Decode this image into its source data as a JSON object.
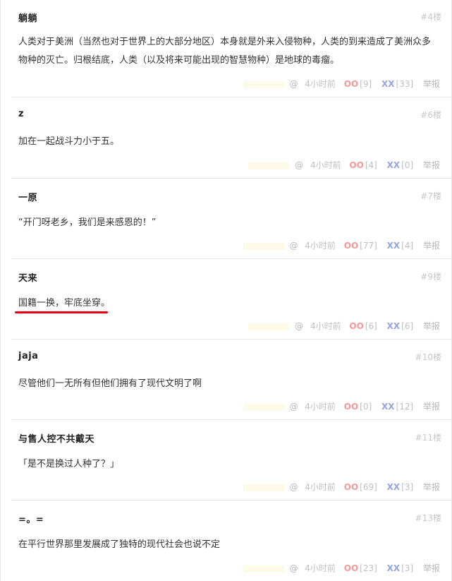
{
  "comments": [
    {
      "author": "躺躺",
      "floor": "#4楼",
      "text": "人类对于美洲（当然也对于世界上的大部分地区）本身就是外来入侵物种，人类的到来造成了美洲众多物种的灭亡。归根结底，人类（以及将来可能出现的智慧物种）是地球的毒瘤。",
      "time": "4小时前",
      "oo_count": "[9]",
      "xx_count": "[33]"
    },
    {
      "author": "z",
      "floor": "#6楼",
      "text": "加在一起战斗力小于五。",
      "time": "4小时前",
      "oo_count": "[4]",
      "xx_count": "[0]"
    },
    {
      "author": "一原",
      "floor": "#7楼",
      "text": "“开门呀老乡，我们是来感恩的！”",
      "time": "4小时前",
      "oo_count": "[77]",
      "xx_count": "[4]"
    },
    {
      "author": "天来",
      "floor": "#9楼",
      "text": "国籍一换，牢底坐穿。",
      "time": "4小时前",
      "oo_count": "[6]",
      "xx_count": "[6]"
    },
    {
      "author": "jaja",
      "floor": "#10楼",
      "text": "尽管他们一无所有但他们拥有了现代文明了啊",
      "time": "4小时前",
      "oo_count": "[0]",
      "xx_count": "[12]"
    },
    {
      "author": "与售人控不共戴天",
      "floor": "#11楼",
      "text": "「是不是换过人种了？」",
      "time": "4小时前",
      "oo_count": "[69]",
      "xx_count": "[3]"
    },
    {
      "author": "=。=",
      "floor": "#13楼",
      "text": "在平行世界那里发展成了独特的现代社会也说不定",
      "time": "4小时前",
      "oo_count": "[23]",
      "xx_count": "[3]"
    }
  ],
  "labels": {
    "at": "@",
    "oo": "OO",
    "xx": "XX",
    "report": "举报"
  },
  "colors": {
    "oo": "#ee4444",
    "xx": "#3b5dc9",
    "underline": "#e60012"
  }
}
